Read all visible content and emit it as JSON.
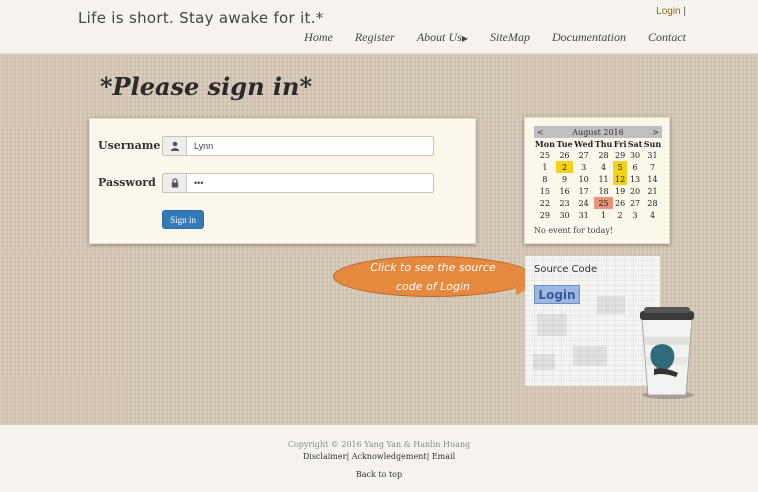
{
  "header": {
    "tagline": "Life is short. Stay awake for it.*",
    "login_link": "Login",
    "separator": "|",
    "nav": [
      {
        "label": "Home"
      },
      {
        "label": "Register"
      },
      {
        "label": "About Us"
      },
      {
        "label": "SiteMap"
      },
      {
        "label": "Documentation"
      },
      {
        "label": "Contact"
      }
    ]
  },
  "page": {
    "title": "*Please sign in*"
  },
  "login_form": {
    "username_label": "Username",
    "username_value": "Lynn",
    "password_label": "Password",
    "password_value": "•••",
    "signin_label": "Sign in"
  },
  "calendar": {
    "month": "August 2016",
    "prev": "<",
    "next": ">",
    "days": [
      "Mon",
      "Tue",
      "Wed",
      "Thu",
      "Fri",
      "Sat",
      "Sun"
    ],
    "weeks": [
      [
        "25",
        "26",
        "27",
        "28",
        "29",
        "30",
        "31"
      ],
      [
        "1",
        "2",
        "3",
        "4",
        "5",
        "6",
        "7"
      ],
      [
        "8",
        "9",
        "10",
        "11",
        "12",
        "13",
        "14"
      ],
      [
        "15",
        "16",
        "17",
        "18",
        "19",
        "20",
        "21"
      ],
      [
        "22",
        "23",
        "24",
        "25",
        "26",
        "27",
        "28"
      ],
      [
        "29",
        "30",
        "31",
        "1",
        "2",
        "3",
        "4"
      ]
    ],
    "no_event": "No event for today!",
    "highlight_color": "#f5d21a",
    "today_color": "#e8937a"
  },
  "source": {
    "title": "Source Code",
    "button": "Login",
    "callout_line1": "Click to see the source",
    "callout_line2": "code of Login"
  },
  "footer": {
    "copyright": "Copyright © 2016 Yang Yan & Hanlin Huang",
    "disclaimer": "Disclaimer",
    "acknowledgement": "Acknowledgement",
    "email": "Email",
    "back_to_top": "Back to top"
  }
}
